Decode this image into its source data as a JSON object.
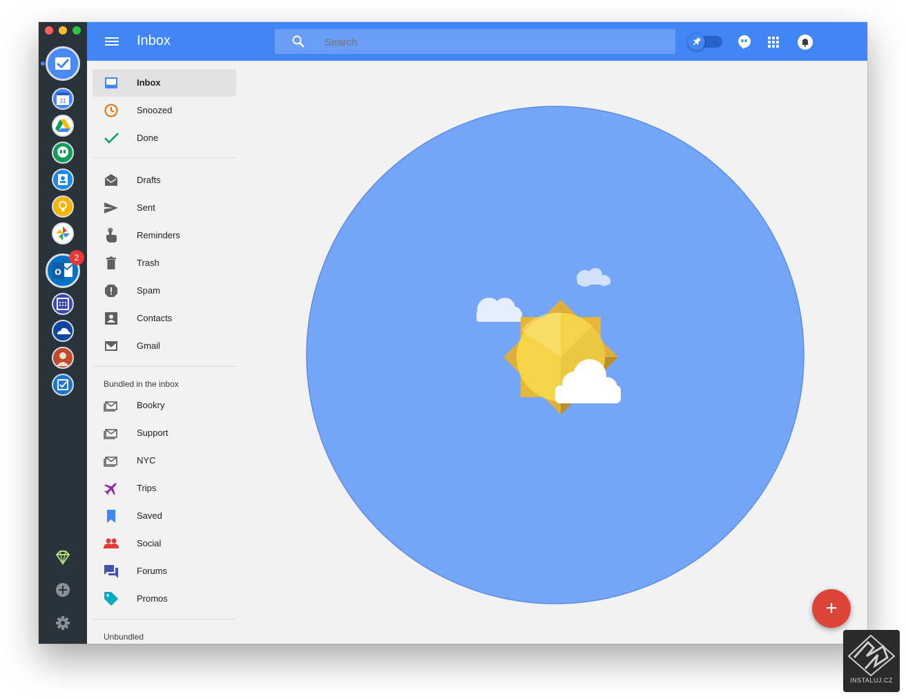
{
  "app": {
    "title": "Inbox",
    "search_placeholder": "Search",
    "brand_color": "#4285f4"
  },
  "rail": {
    "apps": [
      "inbox-app",
      "calendar-app",
      "drive-app",
      "hangouts-app",
      "contacts-app",
      "keep-app",
      "photos-app",
      "outlook-app",
      "outlook-calendar-app",
      "onedrive-app",
      "profile-app",
      "tasks-app"
    ],
    "calendar_day": "31",
    "outlook_badge": "2",
    "outlook_letter": "o"
  },
  "nav": {
    "primary": [
      {
        "label": "Inbox"
      },
      {
        "label": "Snoozed"
      },
      {
        "label": "Done"
      }
    ],
    "secondary": [
      {
        "label": "Drafts"
      },
      {
        "label": "Sent"
      },
      {
        "label": "Reminders"
      },
      {
        "label": "Trash"
      },
      {
        "label": "Spam"
      },
      {
        "label": "Contacts"
      },
      {
        "label": "Gmail"
      }
    ],
    "bundled_header": "Bundled in the inbox",
    "bundles": [
      {
        "label": "Bookry"
      },
      {
        "label": "Support"
      },
      {
        "label": "NYC"
      },
      {
        "label": "Trips"
      },
      {
        "label": "Saved"
      },
      {
        "label": "Social"
      },
      {
        "label": "Forums"
      },
      {
        "label": "Promos"
      }
    ],
    "unbundled_header": "Unbundled"
  },
  "fab": {
    "symbol": "+"
  },
  "watermark": {
    "text": "INSTALUJ.CZ"
  }
}
